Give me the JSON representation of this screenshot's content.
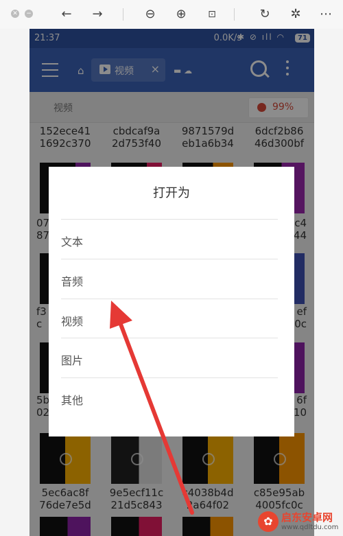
{
  "status_bar": {
    "time": "21:37",
    "speed": "0.0K/s",
    "battery": "71"
  },
  "app_bar": {
    "tab_label": "视频"
  },
  "path_bar": {
    "path": "视频",
    "storage_percent": "99%"
  },
  "files": [
    {
      "line1": "152ece41",
      "line2": "1692c370"
    },
    {
      "line1": "cbdcaf9a",
      "line2": "2d753f40"
    },
    {
      "line1": "9871579d",
      "line2": "eb1a6b34"
    },
    {
      "line1": "6dcf2b86",
      "line2": "46d300bf"
    },
    {
      "line1": "07",
      "line2": "87"
    },
    {
      "line1": "",
      "line2": ""
    },
    {
      "line1": "",
      "line2": ""
    },
    {
      "line1": "c4",
      "line2": "44"
    },
    {
      "line1": "f3",
      "line2": "c"
    },
    {
      "line1": "",
      "line2": ""
    },
    {
      "line1": "",
      "line2": ""
    },
    {
      "line1": "ef",
      "line2": "0c"
    },
    {
      "line1": "5b",
      "line2": "02"
    },
    {
      "line1": "",
      "line2": ""
    },
    {
      "line1": "",
      "line2": ""
    },
    {
      "line1": "6f",
      "line2": "10"
    },
    {
      "line1": "5ec6ac8f",
      "line2": "76de7e5d"
    },
    {
      "line1": "9e5ecf11c",
      "line2": "21d5c843"
    },
    {
      "line1": "c4038b4d",
      "line2": "2a64f02"
    },
    {
      "line1": "c85e95ab",
      "line2": "4005fc0c"
    }
  ],
  "dialog": {
    "title": "打开为",
    "options": [
      "文本",
      "音频",
      "视频",
      "图片",
      "其他"
    ]
  },
  "watermark": {
    "name": "启东安卓网",
    "url": "www.qdltdu.com"
  },
  "colors": {
    "app_bar": "#3b63b9",
    "status_bar": "#2f52a3",
    "accent_red": "#d94a3a",
    "arrow": "#e53935"
  }
}
